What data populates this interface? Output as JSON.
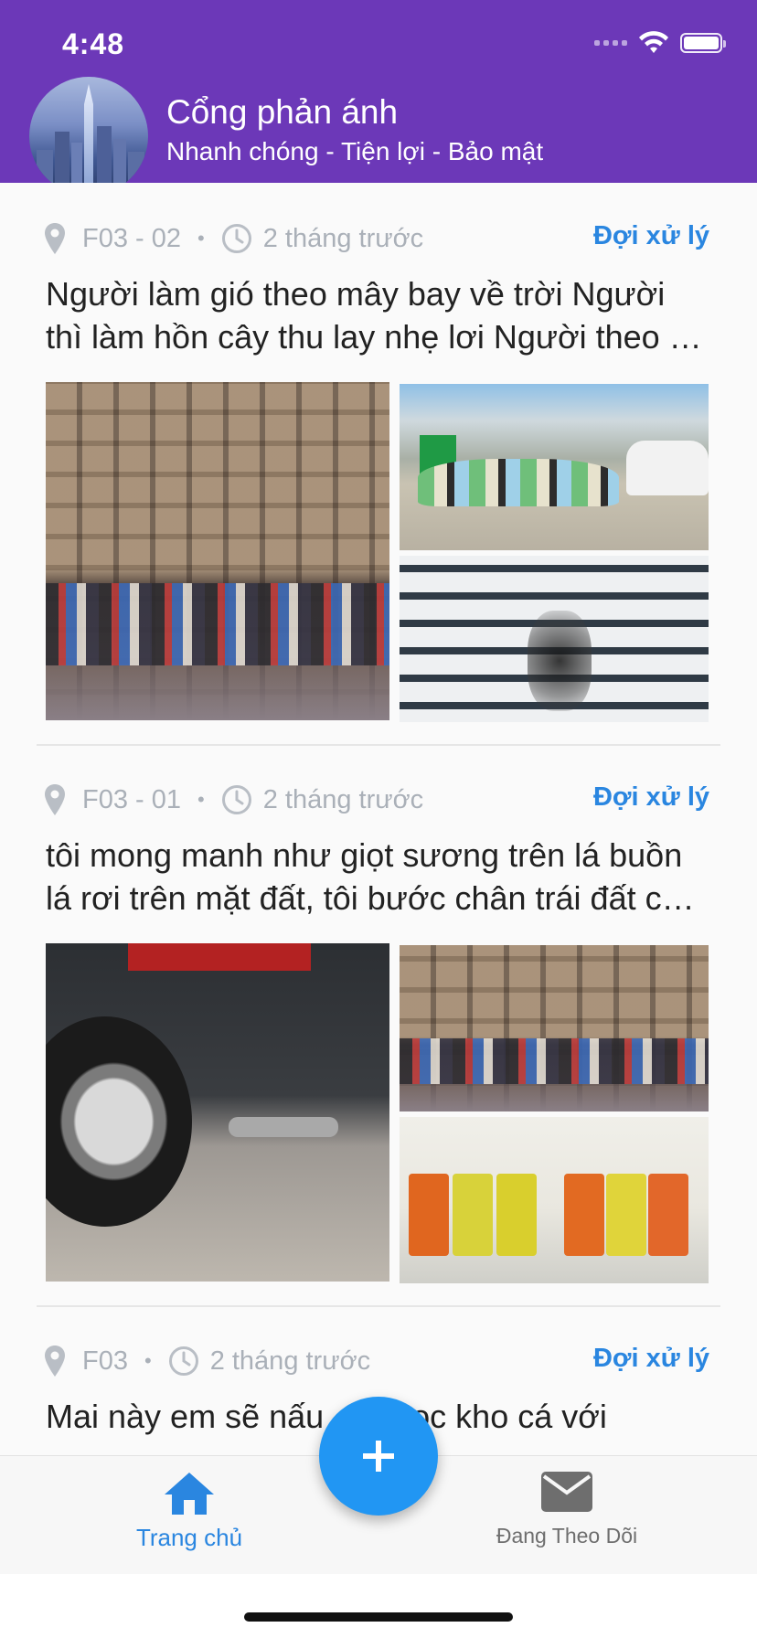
{
  "status_bar": {
    "time": "4:48"
  },
  "header": {
    "title": "Cổng phản ánh",
    "subtitle": "Nhanh chóng - Tiện lợi - Bảo mật"
  },
  "posts": [
    {
      "location": "F03 - 02",
      "time_ago": "2 tháng trước",
      "status": "Đợi xử lý",
      "text_line1": "Người làm gió theo mây bay về trời Người",
      "text_line2": "thì làm hồn cây thu lay nhẹ lơi Người theo …"
    },
    {
      "location": "F03 - 01",
      "time_ago": "2 tháng trước",
      "status": "Đợi xử lý",
      "text_line1": "tôi mong manh như giọt sương trên lá buồn",
      "text_line2": "lá rơi trên mặt đất, tôi bước chân trái đất c…"
    },
    {
      "location": "F03",
      "time_ago": "2 tháng trước",
      "status": "Đợi xử lý",
      "text_line1": "Mai này em sẽ nấu",
      "text_line1b": "Học kho cá với"
    }
  ],
  "bottom_nav": {
    "home_label": "Trang chủ",
    "follow_label": "Đang Theo Dõi"
  },
  "colors": {
    "header_bg": "#6c38b8",
    "accent": "#2a86e0",
    "fab": "#2196f3"
  }
}
